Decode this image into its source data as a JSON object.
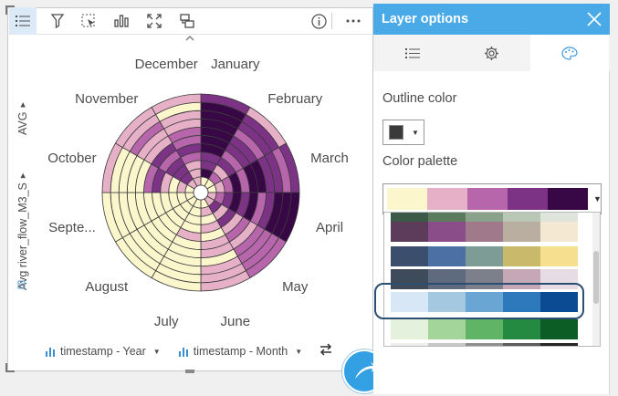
{
  "toolbar": {
    "icons": [
      "legend-icon",
      "filter-icon",
      "selection-icon",
      "chart-type-icon",
      "maximize-icon",
      "flip-card-icon",
      "info-icon",
      "more-options-icon"
    ]
  },
  "chart": {
    "left_axis_top": "AVG",
    "left_axis_bottom": "Avg river_flow_M3_S",
    "x_field": "timestamp - Year",
    "y_field": "timestamp - Month"
  },
  "chart_data": {
    "type": "heatmap",
    "categories": [
      "January",
      "February",
      "March",
      "April",
      "May",
      "June",
      "July",
      "August",
      "Septe...",
      "October",
      "November",
      "December"
    ],
    "rings": 11,
    "values": [
      [
        0,
        4,
        3,
        3,
        4,
        4,
        4,
        4,
        4,
        4,
        3
      ],
      [
        0,
        2,
        1,
        3,
        2,
        3,
        3,
        2,
        3,
        3,
        1
      ],
      [
        0,
        1,
        2,
        4,
        2,
        4,
        4,
        3,
        3,
        2,
        3
      ],
      [
        1,
        2,
        3,
        4,
        3,
        4,
        2,
        3,
        4,
        4,
        4
      ],
      [
        1,
        3,
        1,
        3,
        1,
        2,
        1,
        2,
        2,
        2,
        2
      ],
      [
        0,
        1,
        0,
        1,
        0,
        1,
        1,
        0,
        1,
        1,
        1
      ],
      [
        0,
        0,
        0,
        0,
        1,
        0,
        0,
        0,
        0,
        0,
        0
      ],
      [
        0,
        0,
        0,
        0,
        0,
        0,
        0,
        0,
        0,
        0,
        0
      ],
      [
        0,
        0,
        0,
        0,
        0,
        0,
        0,
        0,
        0,
        0,
        0
      ],
      [
        0,
        1,
        0,
        1,
        3,
        2,
        0,
        0,
        0,
        0,
        1
      ],
      [
        1,
        3,
        3,
        3,
        2,
        3,
        1,
        1,
        2,
        1,
        1
      ],
      [
        1,
        1,
        1,
        2,
        3,
        2,
        2,
        1,
        1,
        0,
        1
      ]
    ],
    "palette": [
      "#fbf6cc",
      "#e6b0c6",
      "#b766ac",
      "#7c3285",
      "#380745"
    ]
  },
  "panel": {
    "title": "Layer options",
    "tabs": [
      "legend-tab",
      "settings-tab",
      "style-tab"
    ],
    "outline_label": "Outline color",
    "outline_color": "#3a3a3a",
    "palette_label": "Color palette",
    "selected_palette": [
      "#fbf6cc",
      "#e6b0c6",
      "#b766ac",
      "#7c3285",
      "#380745"
    ],
    "palettes": [
      [
        "#3d5a48",
        "#5b7b5e",
        "#8aa28a",
        "#b9c7b6",
        "#dfe5dc"
      ],
      [
        "#5c3c5a",
        "#8a4d89",
        "#a0798a",
        "#b9aea0",
        "#f5e8d3"
      ],
      [
        "#3b4e6e",
        "#4d70a4",
        "#7c9c95",
        "#c9b96a",
        "#f6e08f"
      ],
      [
        "#3f4a5b",
        "#5f6a7e",
        "#7d7f8a",
        "#c6a7b5",
        "#e7dbe4"
      ],
      [
        "#d7e7f5",
        "#a5c8e1",
        "#6aa6d3",
        "#2e79bb",
        "#0b4b94"
      ],
      [
        "#e4f2dd",
        "#a3d59b",
        "#5fb466",
        "#248a42",
        "#0b5d25"
      ],
      [
        "#eeeeee",
        "#c7c7c7",
        "#8f8f8f",
        "#5a5a5a",
        "#262626"
      ]
    ]
  }
}
